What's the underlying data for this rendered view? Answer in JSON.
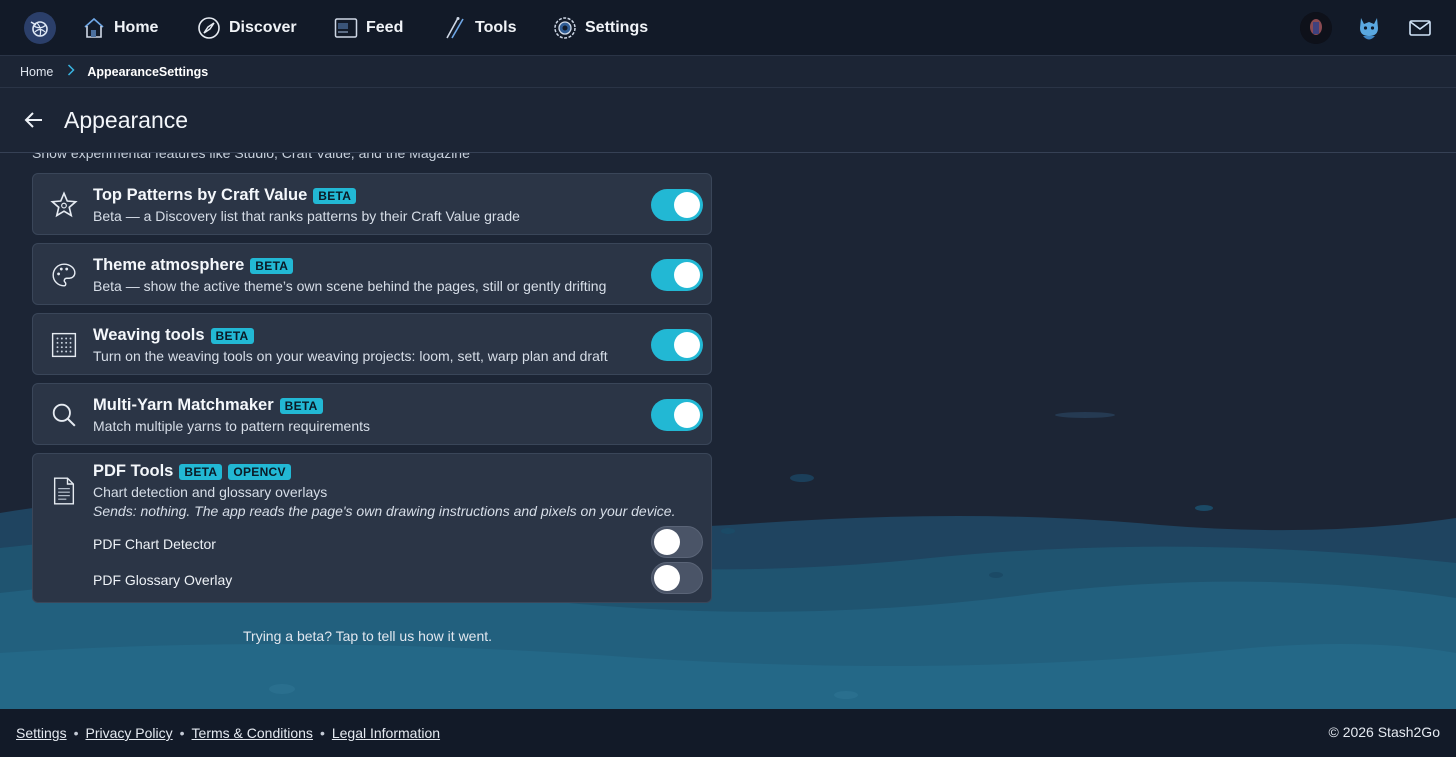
{
  "nav": {
    "items": [
      {
        "label": "Home",
        "icon": "home-icon"
      },
      {
        "label": "Discover",
        "icon": "compass-icon"
      },
      {
        "label": "Feed",
        "icon": "feed-icon"
      },
      {
        "label": "Tools",
        "icon": "needles-icon"
      },
      {
        "label": "Settings",
        "icon": "gear-icon"
      }
    ],
    "right_icons": [
      "user-avatar",
      "cat-mascot-icon",
      "mail-icon"
    ]
  },
  "breadcrumb": {
    "home": "Home",
    "current": "AppearanceSettings"
  },
  "page": {
    "title": "Appearance"
  },
  "intro_text": "Show experimental features like Studio, Craft Value, and the Magazine",
  "features": [
    {
      "title": "Top Patterns by Craft Value",
      "badges": [
        "BETA"
      ],
      "desc": "Beta — a Discovery list that ranks patterns by their Craft Value grade",
      "enabled": true,
      "icon": "star-icon"
    },
    {
      "title": "Theme atmosphere",
      "badges": [
        "BETA"
      ],
      "desc": "Beta — show the active theme’s own scene behind the pages, still or gently drifting",
      "enabled": true,
      "icon": "palette-icon"
    },
    {
      "title": "Weaving tools",
      "badges": [
        "BETA"
      ],
      "desc": "Turn on the weaving tools on your weaving projects: loom, sett, warp plan and draft",
      "enabled": true,
      "icon": "loom-grid-icon"
    },
    {
      "title": "Multi-Yarn Matchmaker",
      "badges": [
        "BETA"
      ],
      "desc": "Match multiple yarns to pattern requirements",
      "enabled": true,
      "icon": "search-icon"
    }
  ],
  "pdf_tools": {
    "title": "PDF Tools",
    "badges": [
      "BETA",
      "OPENCV"
    ],
    "desc": "Chart detection and glossary overlays",
    "note": "Sends: nothing. The app reads the page's own drawing instructions and pixels on your device.",
    "icon": "document-icon",
    "subs": [
      {
        "label": "PDF Chart Detector",
        "enabled": false
      },
      {
        "label": "PDF Glossary Overlay",
        "enabled": false
      }
    ]
  },
  "feedback_text": "Trying a beta? Tap to tell us how it went.",
  "footer": {
    "links": [
      "Settings",
      "Privacy Policy",
      "Terms & Conditions",
      "Legal Information"
    ],
    "separator": "•",
    "copyright": "© 2026 Stash2Go"
  },
  "colors": {
    "accent": "#22b8d4",
    "background": "#1c2535",
    "card": "#2b3546",
    "nav": "#121a28"
  }
}
